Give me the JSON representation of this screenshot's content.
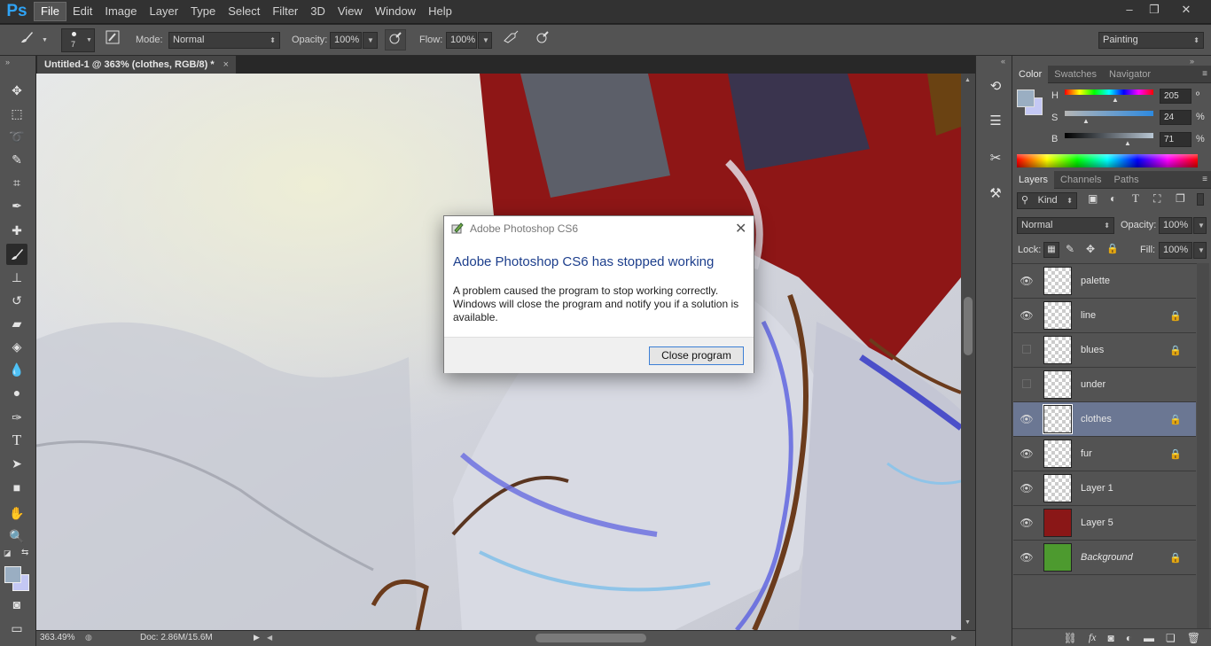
{
  "app": {
    "logo": "Ps",
    "window_buttons": [
      "–",
      "❐",
      "✕"
    ]
  },
  "menus": [
    "File",
    "Edit",
    "Image",
    "Layer",
    "Type",
    "Select",
    "Filter",
    "3D",
    "View",
    "Window",
    "Help"
  ],
  "options": {
    "brush_size": "7",
    "mode_label": "Mode:",
    "mode_value": "Normal",
    "opacity_label": "Opacity:",
    "opacity_value": "100%",
    "flow_label": "Flow:",
    "flow_value": "100%",
    "workspace": "Painting"
  },
  "document": {
    "tab_title": "Untitled-1 @ 363% (clothes, RGB/8) *",
    "close": "×"
  },
  "status": {
    "zoom": "363.49%",
    "doc": "Doc: 2.86M/15.6M"
  },
  "color_panel": {
    "tabs": [
      "Color",
      "Swatches",
      "Navigator"
    ],
    "h_label": "H",
    "h_value": "205",
    "h_pos": 0.57,
    "s_label": "S",
    "s_value": "24",
    "s_pos": 0.24,
    "b_label": "B",
    "b_value": "71",
    "b_pos": 0.71,
    "unit_h": "º",
    "unit_s": "%",
    "unit_b": "%",
    "foreground": "#9aaec2",
    "background": "#c4c8f4"
  },
  "layers_panel": {
    "tabs": [
      "Layers",
      "Channels",
      "Paths"
    ],
    "filter_kind": "Kind",
    "blend_mode": "Normal",
    "opacity_label": "Opacity:",
    "opacity_value": "100%",
    "lock_label": "Lock:",
    "fill_label": "Fill:",
    "fill_value": "100%",
    "layers": [
      {
        "name": "palette",
        "visible": true,
        "locked": false,
        "selected": false,
        "fill": ""
      },
      {
        "name": "line",
        "visible": true,
        "locked": true,
        "selected": false,
        "fill": ""
      },
      {
        "name": "blues",
        "visible": false,
        "locked": true,
        "selected": false,
        "fill": ""
      },
      {
        "name": "under",
        "visible": false,
        "locked": false,
        "selected": false,
        "fill": ""
      },
      {
        "name": "clothes",
        "visible": true,
        "locked": true,
        "selected": true,
        "fill": ""
      },
      {
        "name": "fur",
        "visible": true,
        "locked": true,
        "selected": false,
        "fill": ""
      },
      {
        "name": "Layer 1",
        "visible": true,
        "locked": false,
        "selected": false,
        "fill": ""
      },
      {
        "name": "Layer 5",
        "visible": true,
        "locked": false,
        "selected": false,
        "fill": "#8a1717"
      },
      {
        "name": "Background",
        "visible": true,
        "locked": true,
        "selected": false,
        "fill": "#4d9a2f"
      }
    ]
  },
  "dialog": {
    "title": "Adobe Photoshop CS6",
    "heading": "Adobe Photoshop CS6 has stopped working",
    "message": "A problem caused the program to stop working correctly. Windows will close the program and notify you if a solution is available.",
    "button": "Close program"
  }
}
